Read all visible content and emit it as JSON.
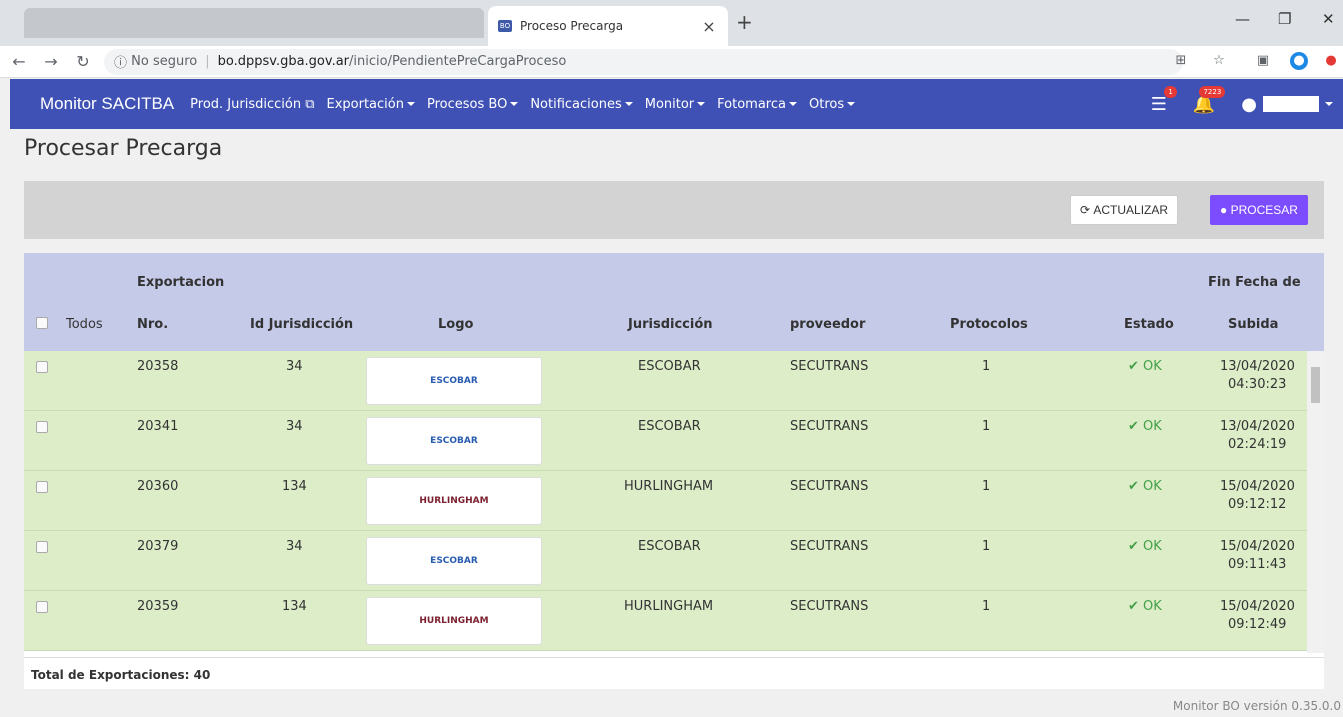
{
  "browser": {
    "tab_title": "Proceso Precarga",
    "tab_favicon": "BO",
    "insecure_label": "No seguro",
    "url_host": "bo.dppsv.gba.gov.ar",
    "url_path": "/inicio/PendientePreCargaProceso"
  },
  "navbar": {
    "brand": "Monitor SACITBA",
    "items": [
      {
        "label": "Prod. Jurisdicción",
        "icon": "external-link-icon"
      },
      {
        "label": "Exportación"
      },
      {
        "label": "Procesos BO"
      },
      {
        "label": "Notificaciones"
      },
      {
        "label": "Monitor"
      },
      {
        "label": "Fotomarca"
      },
      {
        "label": "Otros"
      }
    ],
    "list_badge": "1",
    "bell_badge": "7223"
  },
  "page": {
    "title": "Procesar Precarga",
    "btn_actualizar": "ACTUALIZAR",
    "btn_procesar": "PROCESAR"
  },
  "table": {
    "headers": {
      "todos": "Todos",
      "exportacion": "Exportacion",
      "nro": "Nro.",
      "id_jurisdiccion": "Id Jurisdicción",
      "logo": "Logo",
      "jurisdiccion": "Jurisdicción",
      "proveedor": "proveedor",
      "protocolos": "Protocolos",
      "estado": "Estado",
      "fin_fecha_de": "Fin Fecha de",
      "subida": "Subida"
    },
    "rows": [
      {
        "nro": "20358",
        "id": "34",
        "logo": "ESCOBAR",
        "jurisdiccion": "ESCOBAR",
        "proveedor": "SECUTRANS",
        "protocolos": "1",
        "estado": "OK",
        "fecha": "13/04/2020",
        "hora": "04:30:23"
      },
      {
        "nro": "20341",
        "id": "34",
        "logo": "ESCOBAR",
        "jurisdiccion": "ESCOBAR",
        "proveedor": "SECUTRANS",
        "protocolos": "1",
        "estado": "OK",
        "fecha": "13/04/2020",
        "hora": "02:24:19"
      },
      {
        "nro": "20360",
        "id": "134",
        "logo": "HURLINGHAM",
        "jurisdiccion": "HURLINGHAM",
        "proveedor": "SECUTRANS",
        "protocolos": "1",
        "estado": "OK",
        "fecha": "15/04/2020",
        "hora": "09:12:12"
      },
      {
        "nro": "20379",
        "id": "34",
        "logo": "ESCOBAR",
        "jurisdiccion": "ESCOBAR",
        "proveedor": "SECUTRANS",
        "protocolos": "1",
        "estado": "OK",
        "fecha": "15/04/2020",
        "hora": "09:11:43"
      },
      {
        "nro": "20359",
        "id": "134",
        "logo": "HURLINGHAM",
        "jurisdiccion": "HURLINGHAM",
        "proveedor": "SECUTRANS",
        "protocolos": "1",
        "estado": "OK",
        "fecha": "15/04/2020",
        "hora": "09:12:49"
      }
    ],
    "footer": "Total de Exportaciones: 40"
  },
  "version": "Monitor BO versión 0.35.0.0",
  "colors": {
    "navbar": "#3f51b5",
    "header": "#c5cae9",
    "row": "#dcedc8",
    "procesar": "#7c4dff",
    "ok": "#43a047"
  }
}
